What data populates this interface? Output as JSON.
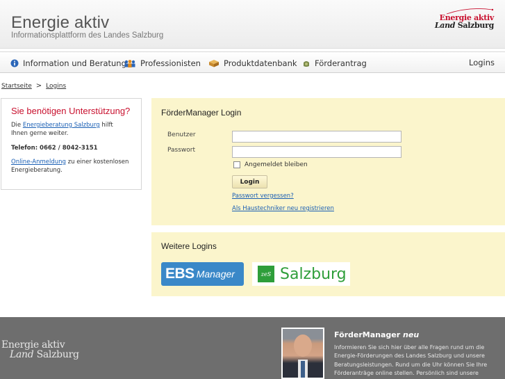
{
  "header": {
    "title": "Energie aktiv",
    "subtitle": "Informationsplattform des Landes Salzburg",
    "logo_line1": "Energie aktiv",
    "logo_line2_italic": "Land",
    "logo_line2": "Salzburg"
  },
  "nav": {
    "items": [
      {
        "label": "Information und Beratung",
        "icon": "info-icon"
      },
      {
        "label": "Professionisten",
        "icon": "people-icon"
      },
      {
        "label": "Produktdatenbank",
        "icon": "box-icon"
      },
      {
        "label": "Förderantrag",
        "icon": "money-icon"
      }
    ],
    "login_label": "Logins"
  },
  "breadcrumb": {
    "home": "Startseite",
    "separator": ">",
    "current": "Logins"
  },
  "support": {
    "title": "Sie benötigen Unterstützung?",
    "text_prefix": "Die",
    "link1": "Energieberatung Salzburg",
    "text_suffix": "hilft Ihnen gerne weiter.",
    "phone": "Telefon: 0662 / 8042-3151",
    "link2": "Online-Anmeldung",
    "text2": "zu einer kostenlosen Energieberatung."
  },
  "login": {
    "title": "FörderManager Login",
    "user_label": "Benutzer",
    "user_value": "",
    "pass_label": "Passwort",
    "pass_value": "",
    "remember_label": "Angemeldet bleiben",
    "button": "Login",
    "forgot_link": "Passwort vergessen?",
    "register_link": "Als Haustechniker neu registrieren"
  },
  "more_logins": {
    "title": "Weitere Logins",
    "ebs_bold": "EBS",
    "ebs_rest": "Manager",
    "zs_mark": "zeS",
    "zs_text": "Salzburg"
  },
  "footer": {
    "logo_line1": "Energie aktiv",
    "logo_line2_italic": "Land",
    "logo_line2": "Salzburg",
    "title": "FörderManager",
    "title_italic": "neu",
    "text": "Informieren Sie sich hier über alle Fragen rund um die Energie-Förderungen des Landes Salzburg und unsere Beratungsleistungen. Rund um die Uhr können Sie Ihre Förderanträge online stellen. Persönlich sind unsere"
  },
  "colors": {
    "accent_red": "#c8102e",
    "panel_yellow": "#fbf5cc",
    "link_blue": "#1a5fb4",
    "footer_gray": "#6e6e6e",
    "ebs_blue": "#3a88c8",
    "zs_green": "#2e9e3a"
  }
}
